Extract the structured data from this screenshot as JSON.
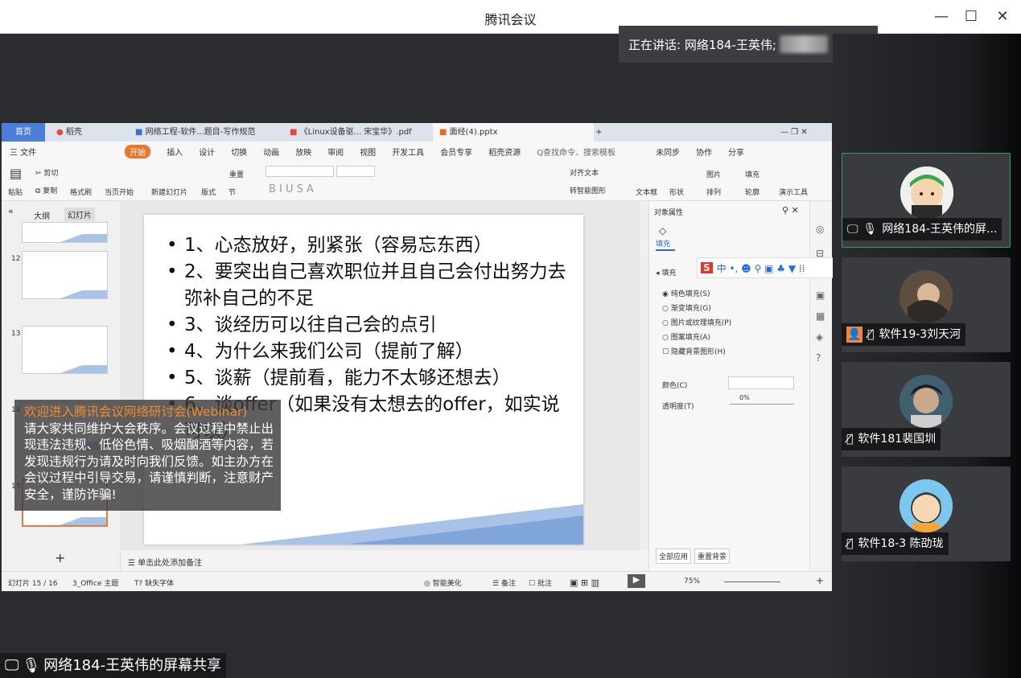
{
  "window": {
    "title": "腾讯会议",
    "controls": [
      "minimize",
      "maximize",
      "close"
    ]
  },
  "speaker_bar": {
    "text": "正在讲话: 网络184-王英伟;"
  },
  "participants": [
    {
      "name": "网络184-王英伟的屏...",
      "icons": [
        "screen-share-icon",
        "mic-on-icon"
      ],
      "active": true
    },
    {
      "name": "软件19-3刘天河",
      "icons": [
        "user-placeholder-icon",
        "mic-muted-icon"
      ],
      "active": false
    },
    {
      "name": "软件181裴国圳",
      "icons": [
        "mic-muted-icon"
      ],
      "active": false
    },
    {
      "name": "软件18-3 陈劭珑",
      "icons": [
        "mic-muted-icon"
      ],
      "active": false
    }
  ],
  "share_label": "网络184-王英伟的屏幕共享",
  "notice": {
    "headline": "欢迎进入腾讯会议网络研讨会(Webinar)",
    "body": "请大家共同维护大会秩序。会议过程中禁止出现违法违规、低俗色情、吸烟酗酒等内容，若发现违规行为请及时向我们反馈。如主办方在会议过程中引导交易，请谨慎判断，注意财产安全，谨防诈骗!"
  },
  "wps": {
    "tabs": [
      "首页",
      "稻壳",
      "网络工程-软件...题目-写作规范",
      "《Linux设备驱... 宋宝华》.pdf",
      "面经(4).pptx"
    ],
    "menu": [
      "三 文件",
      "开始",
      "插入",
      "设计",
      "切换",
      "动画",
      "放映",
      "审阅",
      "视图",
      "开发工具",
      "会员专享",
      "稻壳资源",
      "Q查找命令、搜索模板",
      "未同步",
      "协作",
      "分享"
    ],
    "ribbon": {
      "paste": "粘贴",
      "cut": "剪切",
      "copy": "复制",
      "format_painter": "格式刷",
      "from_current": "当页开始",
      "new_slide": "新建幻灯片",
      "layout": "版式",
      "section": "节",
      "reset": "重置",
      "convert_smart": "转智能图形",
      "align_text": "对齐文本",
      "textbox": "文本框",
      "shape": "形状",
      "arrange": "排列",
      "image": "图片",
      "fill": "填充",
      "outline": "轮廓",
      "present_tools": "演示工具"
    },
    "left_pane": {
      "tabs": [
        "大纲",
        "幻灯片"
      ],
      "slide_numbers": [
        "12",
        "13",
        "14",
        "15"
      ]
    },
    "slide": {
      "bullets": [
        "1、心态放好，别紧张（容易忘东西）",
        "2、要突出自己喜欢职位并且自己会付出努力去弥补自己的不足",
        "3、谈经历可以往自己会的点引",
        "4、为什么来我们公司（提前了解）",
        "5、谈薪（提前看，能力不太够还想去）",
        "6、谈offer（如果没有太想去的offer，如实说可以）"
      ]
    },
    "notes_placeholder": "单击此处添加备注",
    "props": {
      "title": "对象属性",
      "tab_fill": "填充",
      "section_fill": "填充",
      "options": [
        "纯色填充(S)",
        "渐变填充(G)",
        "图片或纹理填充(P)",
        "图案填充(A)"
      ],
      "hide_bg": "隐藏背景图形(H)",
      "color_label": "颜色(C)",
      "transparency_label": "透明度(T)",
      "transparency_value": "0%",
      "apply_all": "全部应用",
      "reset_bg": "重置背景"
    },
    "status": {
      "slide_pos": "幻灯片 15 / 16",
      "theme": "3_Office 主题",
      "missing_font": "缺失字体",
      "smart_beautify": "智能美化",
      "notes": "备注",
      "comments": "批注",
      "zoom": "75%"
    }
  }
}
